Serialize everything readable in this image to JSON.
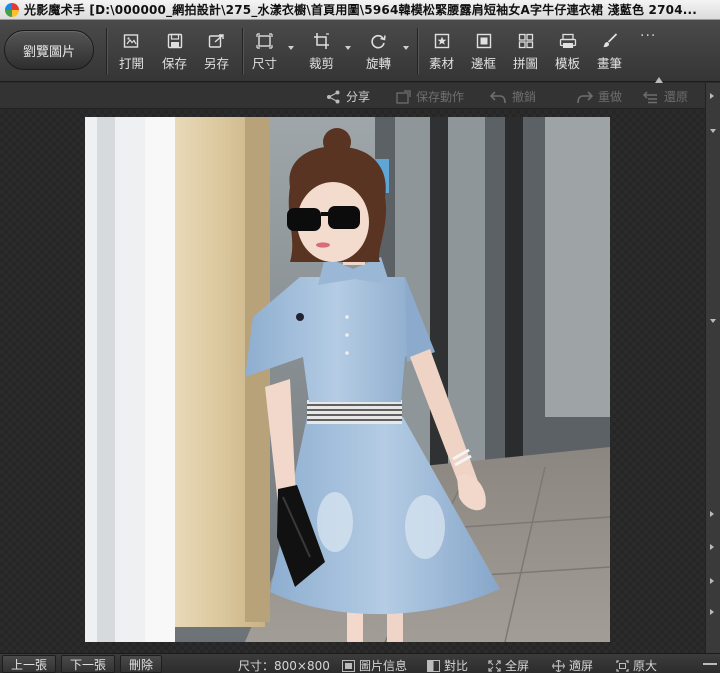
{
  "window": {
    "title": "光影魔术手 [D:\\000000_網拍設計\\275_水漾衣櫥\\首頁用圖\\5964韓模松緊腰露肩短袖女A字牛仔連衣裙 淺藍色 2704..."
  },
  "toolbar": {
    "beautify_label": "劉覽圖片",
    "tools": [
      {
        "label": "打開",
        "icon": "open-icon"
      },
      {
        "label": "保存",
        "icon": "save-icon"
      },
      {
        "label": "另存",
        "icon": "save-as-icon"
      },
      {
        "label": "尺寸",
        "icon": "resize-icon"
      },
      {
        "label": "裁剪",
        "icon": "crop-icon"
      },
      {
        "label": "旋轉",
        "icon": "rotate-icon"
      },
      {
        "label": "素材",
        "icon": "material-icon"
      },
      {
        "label": "邊框",
        "icon": "frame-icon"
      },
      {
        "label": "拼圖",
        "icon": "collage-icon"
      },
      {
        "label": "模板",
        "icon": "template-icon"
      },
      {
        "label": "畫筆",
        "icon": "brush-icon"
      }
    ],
    "more": "···"
  },
  "subbar": {
    "share": "分享",
    "save_action": "保存動作",
    "undo": "撤銷",
    "redo": "重做",
    "restore": "還原"
  },
  "statusbar": {
    "prev": "上一張",
    "next": "下一張",
    "delete": "刪除",
    "size_text": "尺寸：800×800",
    "info": "圖片信息",
    "compare": "對比",
    "fullscreen": "全屏",
    "fit": "適屏",
    "original": "原大"
  },
  "colors": {
    "toolbar_bg": "#3d3d3d",
    "canvas_bg": "#2b2b2b"
  }
}
